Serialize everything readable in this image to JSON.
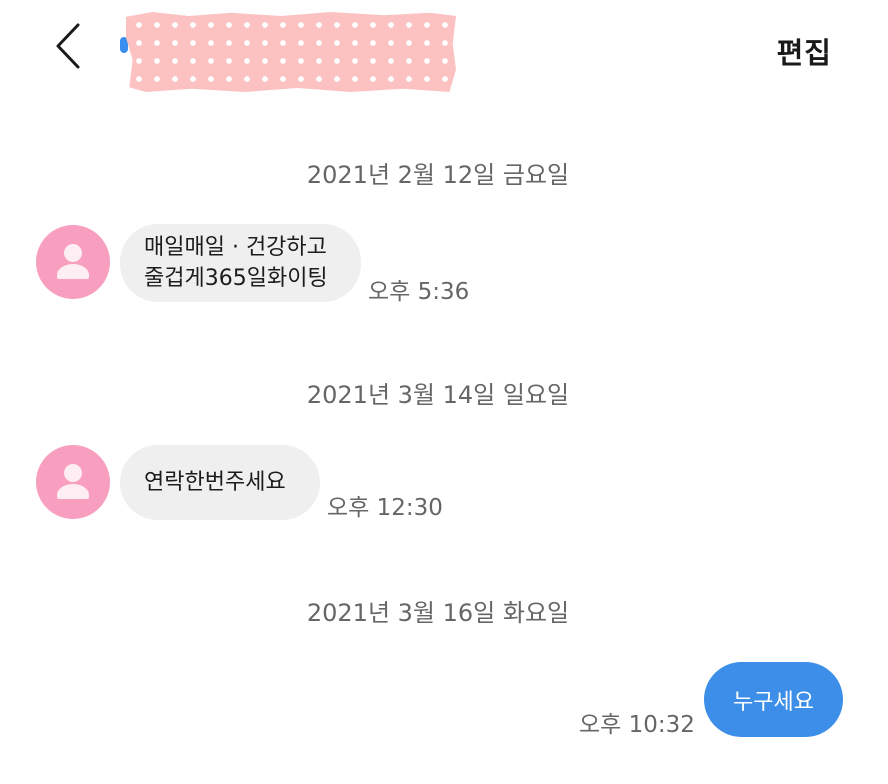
{
  "header": {
    "edit_label": "편집"
  },
  "colors": {
    "incoming_bubble": "#efefef",
    "outgoing_bubble": "#3d8ee8",
    "avatar": "#f89fc0",
    "secondary_text": "#666666"
  },
  "icons": {
    "back": "chevron-left-icon",
    "avatar": "person-silhouette-icon"
  },
  "conversation": [
    {
      "date": "2021년 2월 12일 금요일",
      "message": {
        "direction": "incoming",
        "lines": [
          "매일매일 · 건강하고",
          "줄겁게365일화이팅"
        ],
        "time": "오후 5:36"
      }
    },
    {
      "date": "2021년 3월 14일 일요일",
      "message": {
        "direction": "incoming",
        "lines": [
          "연락한번주세요"
        ],
        "time": "오후 12:30"
      }
    },
    {
      "date": "2021년 3월 16일 화요일",
      "message": {
        "direction": "outgoing",
        "lines": [
          "누구세요"
        ],
        "time": "오후 10:32"
      }
    }
  ]
}
